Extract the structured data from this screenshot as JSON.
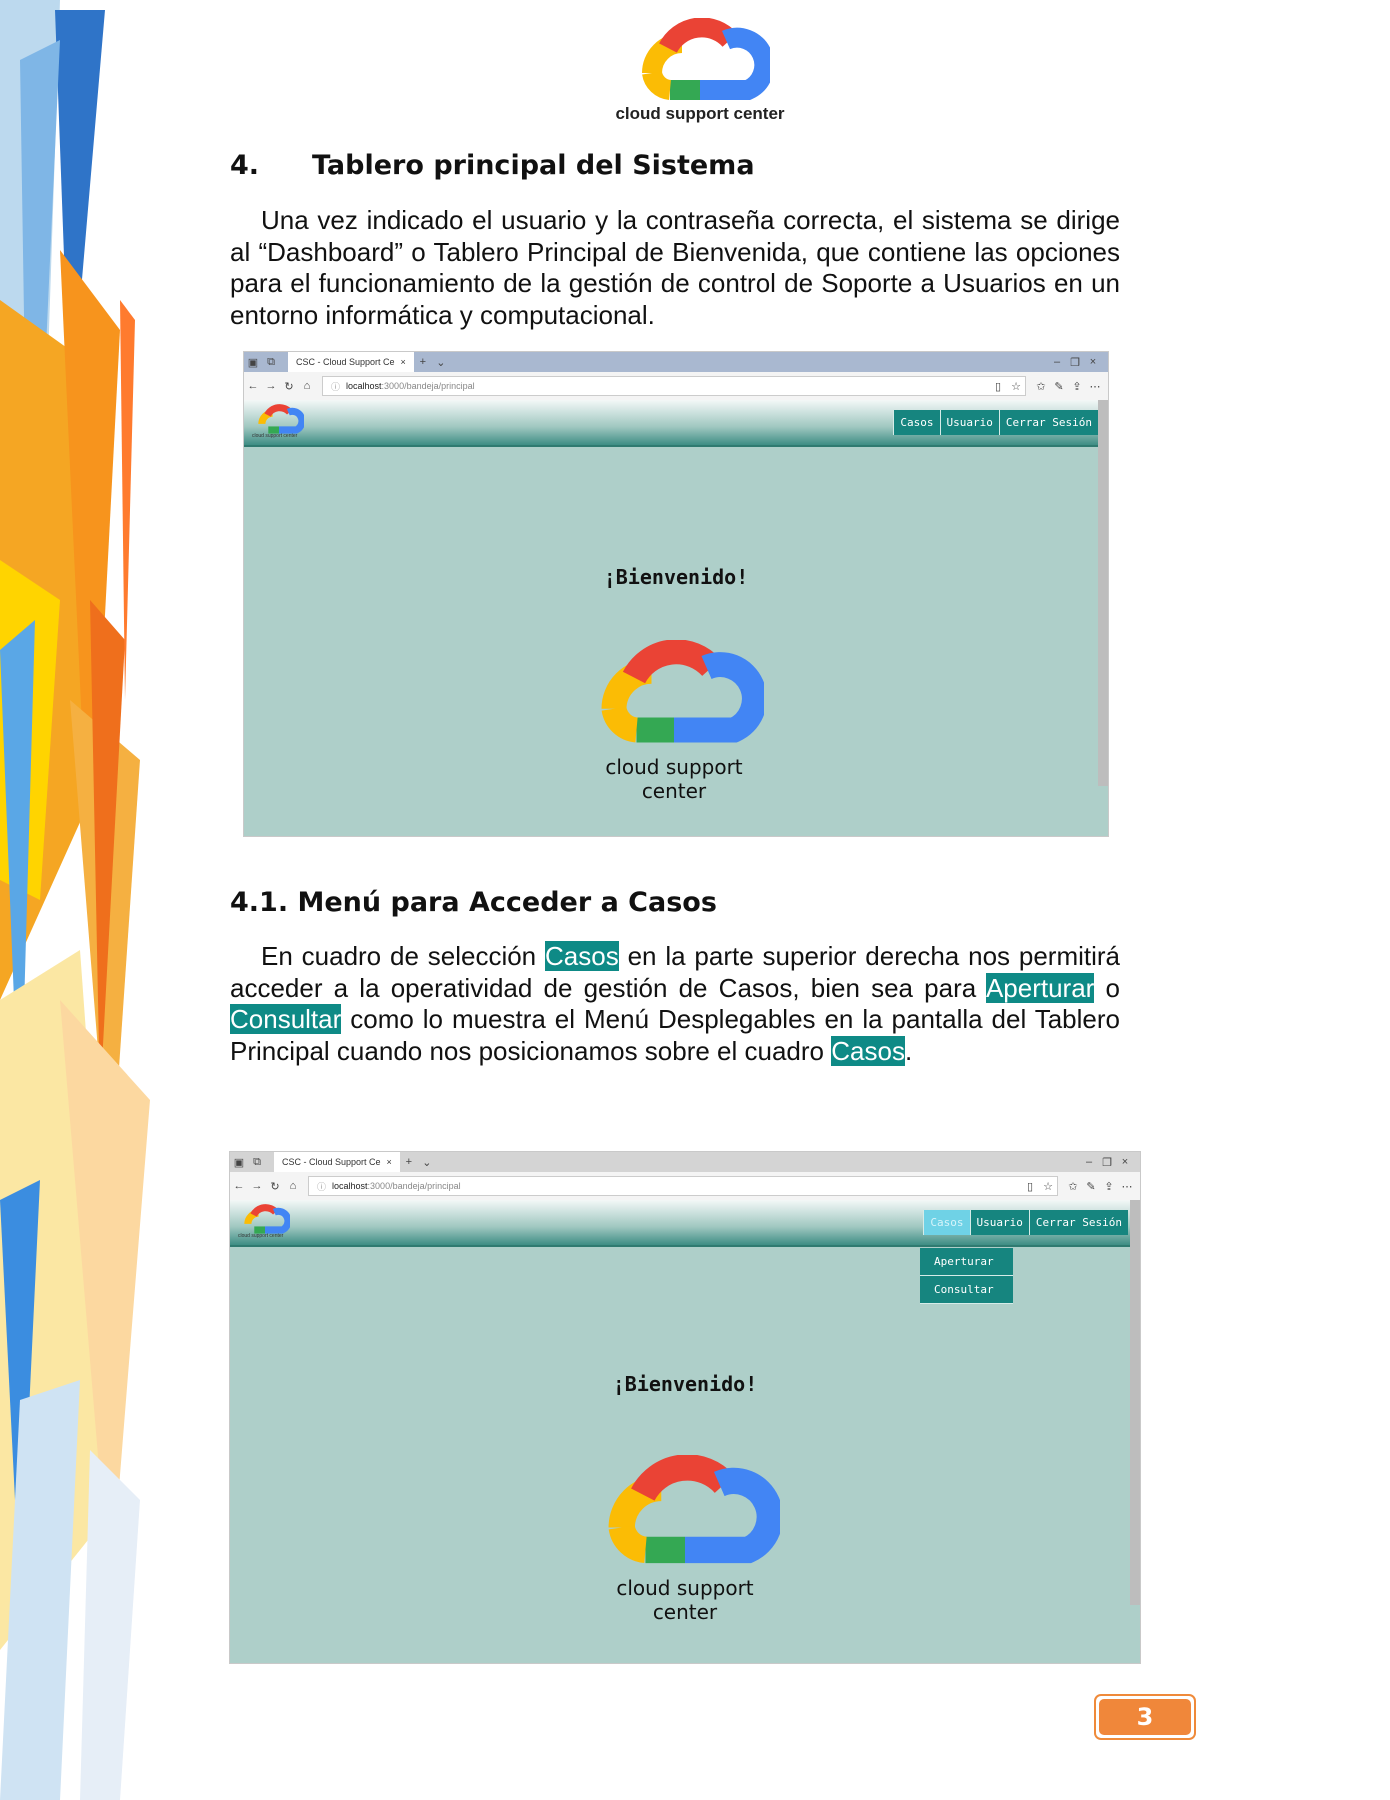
{
  "header": {
    "logo_caption": "cloud support center"
  },
  "section4": {
    "number": "4.",
    "title": "Tablero principal del Sistema",
    "paragraph": "Una vez indicado el usuario y la contraseña correcta, el sistema se dirige al “Dashboard” o Tablero Principal de Bienvenida, que contiene las opciones para el funcionamiento de la gestión de control de Soporte a Usuarios en un entorno informática y computacional."
  },
  "section41": {
    "title": "4.1. Menú para Acceder a Casos",
    "p_part1": "En cuadro de selección",
    "hl_casos": "Casos",
    "p_part2": "en la parte superior derecha nos permitirá acceder a la operatividad de gestión de Casos, bien sea para",
    "hl_aperturar": "Aperturar",
    "p_part3": "o",
    "hl_consultar": "Consultar",
    "p_part4": "como lo muestra el Menú Desplegables en la pantalla del Tablero Principal cuando nos posicionamos sobre el cuadro",
    "hl_casos2": "Casos",
    "p_end": "."
  },
  "browser": {
    "tab_title": "CSC - Cloud Support Ce",
    "url_host": "localhost",
    "url_path": ":3000/bandeja/principal",
    "menu": [
      "Casos",
      "Usuario",
      "Cerrar Sesión"
    ],
    "dropdown": [
      "Aperturar",
      "Consultar"
    ],
    "welcome": "¡Bienvenido!",
    "small_logo_caption": "cloud support center",
    "logo_caption": "cloud support center"
  },
  "page_number": "3",
  "colors": {
    "teal": "#16857f",
    "page_bg": "#aecfc9",
    "highlight": "#0e8a86",
    "badge": "#f0873a"
  }
}
